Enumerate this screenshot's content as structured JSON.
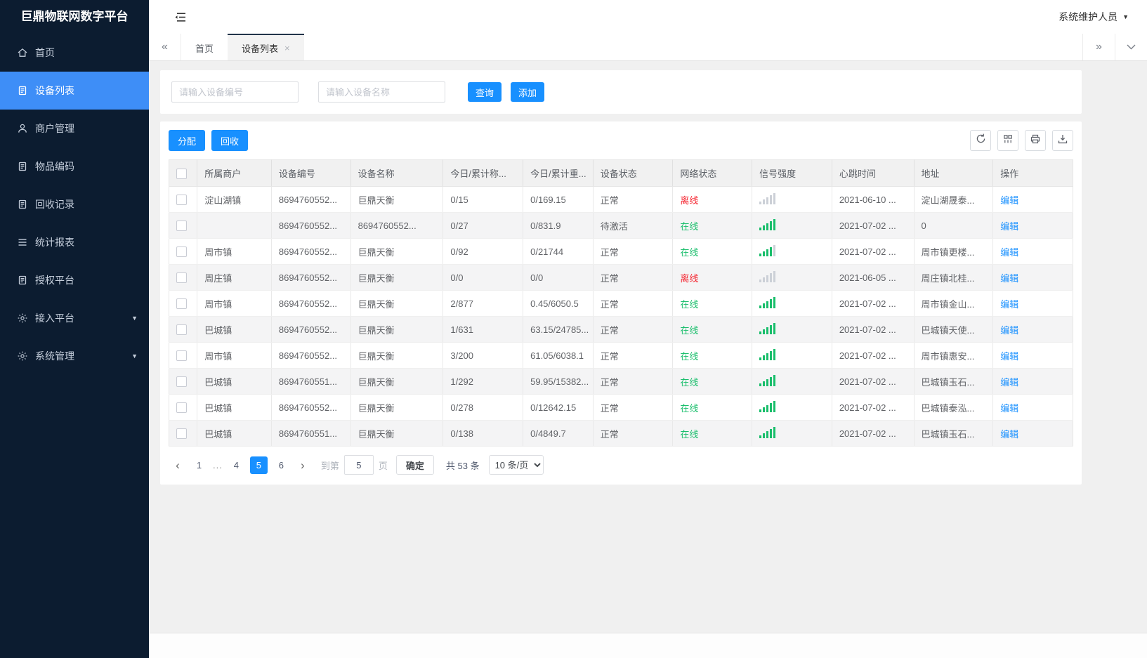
{
  "app": {
    "title": "巨鼎物联网数字平台",
    "user": "系统维护人员"
  },
  "sidebar": {
    "items": [
      {
        "key": "home",
        "icon": "home-icon",
        "label": "首页"
      },
      {
        "key": "device-list",
        "icon": "doc-icon",
        "label": "设备列表",
        "active": true
      },
      {
        "key": "merchant-mgmt",
        "icon": "user-icon",
        "label": "商户管理"
      },
      {
        "key": "item-code",
        "icon": "doc-icon",
        "label": "物品编码"
      },
      {
        "key": "recycle-records",
        "icon": "doc-icon",
        "label": "回收记录"
      },
      {
        "key": "stats-report",
        "icon": "menu-icon",
        "label": "统计报表"
      },
      {
        "key": "auth-platform",
        "icon": "doc-icon",
        "label": "授权平台"
      },
      {
        "key": "access-platform",
        "icon": "gear-icon",
        "label": "接入平台",
        "expandable": true
      },
      {
        "key": "system-mgmt",
        "icon": "gear-icon",
        "label": "系统管理",
        "expandable": true
      }
    ]
  },
  "tabbar": {
    "tabs": [
      {
        "key": "home",
        "label": "首页"
      },
      {
        "key": "device-list",
        "label": "设备列表",
        "active": true,
        "closable": true
      }
    ]
  },
  "search": {
    "device_no_placeholder": "请输入设备编号",
    "device_name_placeholder": "请输入设备名称",
    "query_label": "查询",
    "add_label": "添加"
  },
  "table_toolbar": {
    "assign_label": "分配",
    "recycle_label": "回收",
    "icons": [
      "refresh-icon",
      "columns-icon",
      "print-icon",
      "download-icon"
    ]
  },
  "table": {
    "headers": [
      "所属商户",
      "设备编号",
      "设备名称",
      "今日/累计称...",
      "今日/累计重...",
      "设备状态",
      "网络状态",
      "信号强度",
      "心跳时间",
      "地址",
      "操作"
    ],
    "edit_label": "编辑",
    "rows": [
      {
        "merchant": "淀山湖镇",
        "device_no": "8694760552...",
        "device_name": "巨鼎天衡",
        "count": "0/15",
        "weight": "0/169.15",
        "device_status": "正常",
        "network_status": "离线",
        "online": false,
        "signal": 0,
        "heartbeat": "2021-06-10 ...",
        "address": "淀山湖晟泰..."
      },
      {
        "merchant": "",
        "device_no": "8694760552...",
        "device_name": "8694760552...",
        "count": "0/27",
        "weight": "0/831.9",
        "device_status": "待激活",
        "network_status": "在线",
        "online": true,
        "signal": 5,
        "heartbeat": "2021-07-02 ...",
        "address": "0"
      },
      {
        "merchant": "周市镇",
        "device_no": "8694760552...",
        "device_name": "巨鼎天衡",
        "count": "0/92",
        "weight": "0/21744",
        "device_status": "正常",
        "network_status": "在线",
        "online": true,
        "signal": 4,
        "heartbeat": "2021-07-02 ...",
        "address": "周市镇更楼..."
      },
      {
        "merchant": "周庄镇",
        "device_no": "8694760552...",
        "device_name": "巨鼎天衡",
        "count": "0/0",
        "weight": "0/0",
        "device_status": "正常",
        "network_status": "离线",
        "online": false,
        "signal": 0,
        "heartbeat": "2021-06-05 ...",
        "address": "周庄镇北桂..."
      },
      {
        "merchant": "周市镇",
        "device_no": "8694760552...",
        "device_name": "巨鼎天衡",
        "count": "2/877",
        "weight": "0.45/6050.5",
        "device_status": "正常",
        "network_status": "在线",
        "online": true,
        "signal": 5,
        "heartbeat": "2021-07-02 ...",
        "address": "周市镇金山..."
      },
      {
        "merchant": "巴城镇",
        "device_no": "8694760552...",
        "device_name": "巨鼎天衡",
        "count": "1/631",
        "weight": "63.15/24785...",
        "device_status": "正常",
        "network_status": "在线",
        "online": true,
        "signal": 5,
        "heartbeat": "2021-07-02 ...",
        "address": "巴城镇天使..."
      },
      {
        "merchant": "周市镇",
        "device_no": "8694760552...",
        "device_name": "巨鼎天衡",
        "count": "3/200",
        "weight": "61.05/6038.1",
        "device_status": "正常",
        "network_status": "在线",
        "online": true,
        "signal": 5,
        "heartbeat": "2021-07-02 ...",
        "address": "周市镇惠安..."
      },
      {
        "merchant": "巴城镇",
        "device_no": "8694760551...",
        "device_name": "巨鼎天衡",
        "count": "1/292",
        "weight": "59.95/15382...",
        "device_status": "正常",
        "network_status": "在线",
        "online": true,
        "signal": 5,
        "heartbeat": "2021-07-02 ...",
        "address": "巴城镇玉石..."
      },
      {
        "merchant": "巴城镇",
        "device_no": "8694760552...",
        "device_name": "巨鼎天衡",
        "count": "0/278",
        "weight": "0/12642.15",
        "device_status": "正常",
        "network_status": "在线",
        "online": true,
        "signal": 5,
        "heartbeat": "2021-07-02 ...",
        "address": "巴城镇泰泓..."
      },
      {
        "merchant": "巴城镇",
        "device_no": "8694760551...",
        "device_name": "巨鼎天衡",
        "count": "0/138",
        "weight": "0/4849.7",
        "device_status": "正常",
        "network_status": "在线",
        "online": true,
        "signal": 5,
        "heartbeat": "2021-07-02 ...",
        "address": "巴城镇玉石..."
      }
    ]
  },
  "pagination": {
    "pages": [
      "1",
      "...",
      "4",
      "5",
      "6"
    ],
    "active_page": "5",
    "goto_prefix": "到第",
    "goto_value": "5",
    "goto_suffix": "页",
    "confirm_label": "确定",
    "total_label": "共 53 条",
    "page_size": "10 条/页"
  },
  "colors": {
    "accent": "#1890ff",
    "sidebar_bg": "#0c1c30",
    "sidebar_active": "#3e8ef7",
    "online_green": "#19be6b",
    "offline_red": "#f5222d"
  }
}
